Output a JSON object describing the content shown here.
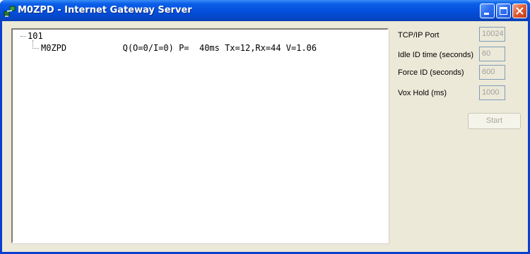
{
  "window": {
    "title": "M0ZPD - Internet Gateway Server"
  },
  "tree": {
    "root_label": "101",
    "child_label": "M0ZPD           Q(O=0/I=0) P=  40ms Tx=12,Rx=44 V=1.06"
  },
  "settings": {
    "tcp_port_label": "TCP/IP Port",
    "tcp_port_value": "10024",
    "idle_id_label": "Idle ID time (seconds)",
    "idle_id_value": "60",
    "force_id_label": "Force ID (seconds)",
    "force_id_value": "600",
    "vox_hold_label": "Vox Hold (ms)",
    "vox_hold_value": "1000"
  },
  "buttons": {
    "start_label": "Start"
  },
  "colors": {
    "titlebar": "#0551de",
    "client_bg": "#ece9d8",
    "close_button": "#e0592f"
  }
}
